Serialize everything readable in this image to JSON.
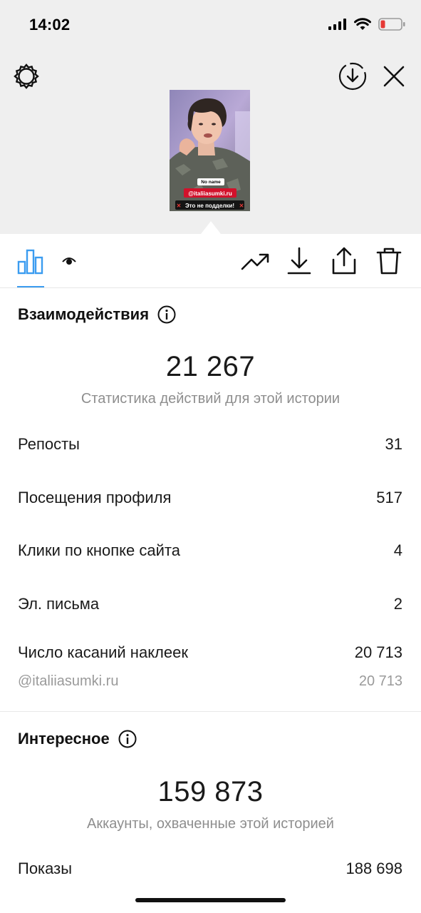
{
  "status_bar": {
    "time": "14:02"
  },
  "story": {
    "sticker_tag": "No name",
    "mention": "@italiiasumki.ru",
    "caption": "Это не подделки!"
  },
  "interactions": {
    "title": "Взаимодействия",
    "total": "21 267",
    "subtitle": "Статистика действий для этой истории",
    "rows": [
      {
        "label": "Репосты",
        "value": "31"
      },
      {
        "label": "Посещения профиля",
        "value": "517"
      },
      {
        "label": "Клики по кнопке сайта",
        "value": "4"
      },
      {
        "label": "Эл. письма",
        "value": "2"
      },
      {
        "label": "Число касаний наклеек",
        "value": "20 713"
      }
    ],
    "sticker_detail": {
      "label": "@italiiasumki.ru",
      "value": "20 713"
    }
  },
  "discovery": {
    "title": "Интересное",
    "total": "159 873",
    "subtitle": "Аккаунты, охваченные этой историей",
    "rows": [
      {
        "label": "Показы",
        "value": "188 698"
      }
    ]
  },
  "colors": {
    "accent": "#3b9cf0",
    "battery_low": "#e53935",
    "top_bg": "#efefef"
  },
  "icons": [
    "settings-icon",
    "download-circle-icon",
    "close-icon",
    "bar-chart-icon",
    "eye-icon",
    "trending-icon",
    "download-icon",
    "share-icon",
    "trash-icon"
  ]
}
